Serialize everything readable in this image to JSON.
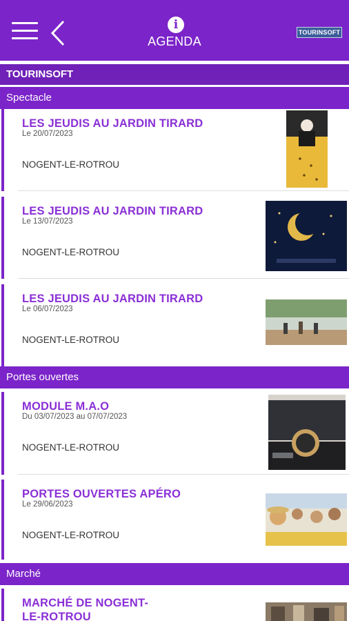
{
  "header": {
    "title": "AGENDA",
    "info_icon": "info-icon",
    "logo_text": "TOURINSOFT"
  },
  "source": {
    "label": "TOURINSOFT"
  },
  "colors": {
    "primary": "#7b24c9",
    "title": "#8a2fd6"
  },
  "sections": [
    {
      "label": "Spectacle",
      "items": [
        {
          "name": "LES JEUDIS AU JARDIN TIRARD",
          "date": "Le 20/07/2023",
          "city": "NOGENT-LE-ROTROU"
        },
        {
          "name": "LES JEUDIS AU JARDIN TIRARD",
          "date": "Le 13/07/2023",
          "city": "NOGENT-LE-ROTROU"
        },
        {
          "name": "LES JEUDIS AU JARDIN TIRARD",
          "date": "Le 06/07/2023",
          "city": "NOGENT-LE-ROTROU"
        }
      ]
    },
    {
      "label": "Portes ouvertes",
      "items": [
        {
          "name": "MODULE M.A.O",
          "date": "Du 03/07/2023 au 07/07/2023",
          "city": "NOGENT-LE-ROTROU"
        },
        {
          "name": "PORTES OUVERTES APÉRO",
          "date": "Le 29/06/2023",
          "city": "NOGENT-LE-ROTROU"
        }
      ]
    },
    {
      "label": "Marché",
      "items": [
        {
          "name": "MARCHÉ DE NOGENT-LE-ROTROU"
        }
      ]
    }
  ]
}
